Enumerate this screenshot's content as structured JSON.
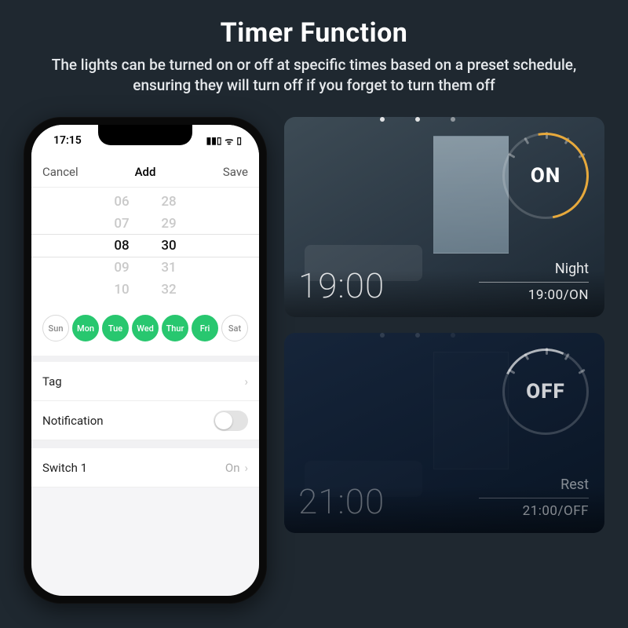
{
  "hero": {
    "title": "Timer Function",
    "subtitle": "The lights can be turned on or off at specific times based on a preset schedule, ensuring they will turn off if you forget to turn them off"
  },
  "phone": {
    "status_time": "17:15",
    "nav": {
      "cancel": "Cancel",
      "title": "Add",
      "save": "Save"
    },
    "wheel_hours": [
      "06",
      "07",
      "08",
      "09",
      "10"
    ],
    "wheel_minutes": [
      "28",
      "29",
      "30",
      "31",
      "32"
    ],
    "selected_hour": "08",
    "selected_minute": "30",
    "days": [
      {
        "label": "Sun",
        "active": false
      },
      {
        "label": "Mon",
        "active": true
      },
      {
        "label": "Tue",
        "active": true
      },
      {
        "label": "Wed",
        "active": true
      },
      {
        "label": "Thur",
        "active": true
      },
      {
        "label": "Fri",
        "active": true
      },
      {
        "label": "Sat",
        "active": false
      }
    ],
    "rows": {
      "tag_label": "Tag",
      "notification_label": "Notification",
      "notification_on": false,
      "switch_label": "Switch 1",
      "switch_value": "On"
    }
  },
  "scenes": {
    "on": {
      "state": "ON",
      "time": "19:00",
      "caption_title": "Night",
      "caption_detail": "19:00/ON"
    },
    "off": {
      "state": "OFF",
      "time": "21:00",
      "caption_title": "Rest",
      "caption_detail": "21:00/OFF"
    }
  }
}
